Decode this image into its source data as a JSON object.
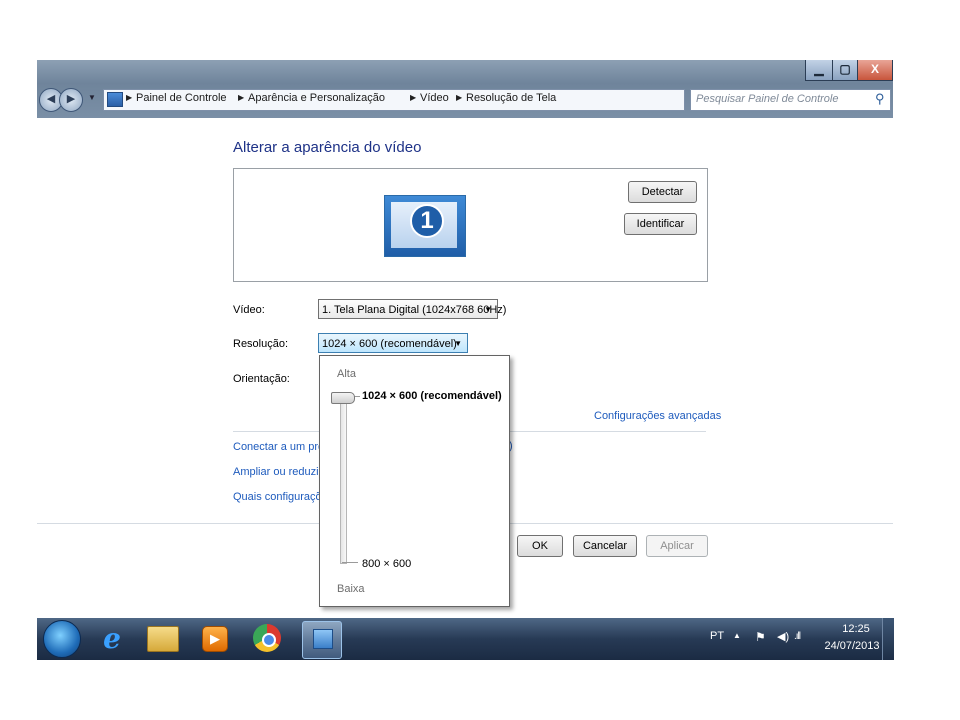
{
  "window": {
    "controls": {
      "minimize": "▁",
      "maximize": "▢",
      "close": "X"
    },
    "address": {
      "breadcrumbs": [
        "Painel de Controle",
        "Aparência e Personalização",
        "Vídeo",
        "Resolução de Tela"
      ],
      "separator": "▶"
    },
    "search": {
      "placeholder": "Pesquisar Painel de Controle"
    }
  },
  "content": {
    "title": "Alterar a aparência do vídeo",
    "monitor_number": "1",
    "detect_label": "Detectar",
    "identify_label": "Identificar",
    "video_label": "Vídeo:",
    "video_value": "1. Tela Plana Digital (1024x768 60Hz)",
    "resolution_label": "Resolução:",
    "resolution_value": "1024 × 600 (recomendável)",
    "orientation_label": "Orientação:",
    "advanced_link": "Configurações avançadas",
    "links": {
      "connect": "Conectar a um projetor",
      "connect_tail": ")",
      "zoom": "Ampliar ou reduzir texto",
      "which": "Quais configurações"
    },
    "ok_label": "OK",
    "cancel_label": "Cancelar",
    "apply_label": "Aplicar"
  },
  "resolution_popup": {
    "high_label": "Alta",
    "low_label": "Baixa",
    "selected": "1024 × 600 (recomendável)",
    "minimum": "800 × 600",
    "slider_level": 1.0
  },
  "taskbar": {
    "language": "PT",
    "time": "12:25",
    "date": "24/07/2013",
    "pinned": [
      "windows-start",
      "internet-explorer",
      "windows-explorer",
      "media-player",
      "chrome",
      "control-panel"
    ]
  },
  "colors": {
    "link": "#1e5bbd",
    "title": "#1e3287",
    "taskbar": "#273a55"
  }
}
